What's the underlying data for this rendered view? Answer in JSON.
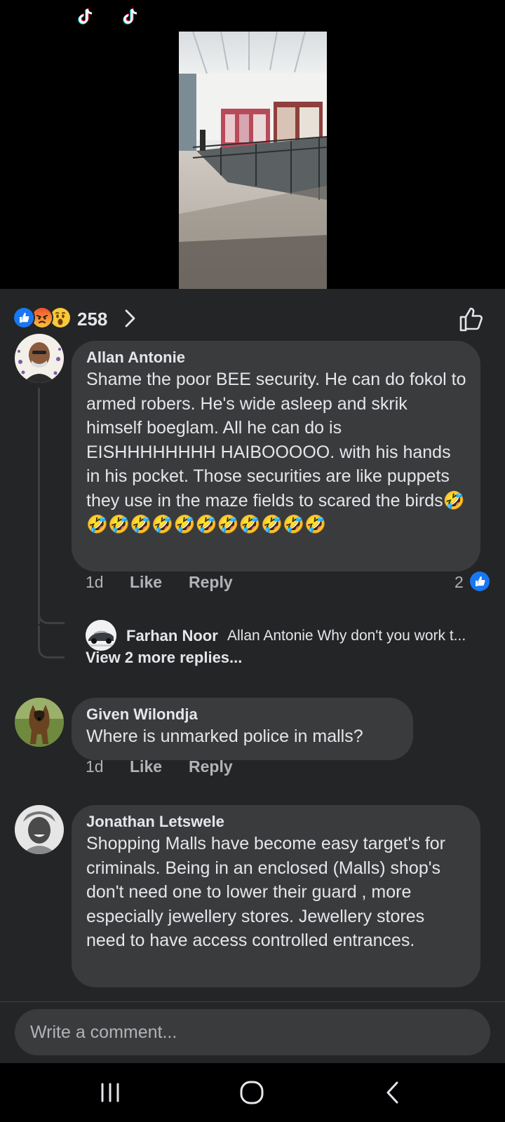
{
  "video": {
    "tiktok_icons": [
      "tiktok-icon",
      "tiktok-icon"
    ]
  },
  "reactions": {
    "icons": [
      "like-reaction",
      "angry-reaction",
      "wow-reaction"
    ],
    "count": "258"
  },
  "comments": [
    {
      "author": "Allan Antonie",
      "text": "Shame the poor BEE security. He can do fokol to armed robers. He's wide asleep and skrik himself boeglam. All he can do is EISHHHHHHHH HAIBOOOOO. with his hands in his pocket. Those securities are like puppets they use in the maze fields to scared the birds🤣🤣🤣🤣🤣🤣🤣🤣🤣🤣🤣🤣",
      "time": "1d",
      "like_label": "Like",
      "reply_label": "Reply",
      "like_count": "2",
      "reply_preview": {
        "author": "Farhan Noor",
        "text": "Allan Antonie Why don't you work t..."
      },
      "view_more": "View 2 more replies..."
    },
    {
      "author": "Given Wilondja",
      "text": "Where is unmarked police in malls?",
      "time": "1d",
      "like_label": "Like",
      "reply_label": "Reply"
    },
    {
      "author": "Jonathan Letswele",
      "text": "Shopping Malls have become easy target's for criminals. Being in an enclosed (Malls) shop's don't need one to lower their guard , more especially jewellery stores. Jewellery stores need to have access controlled entrances."
    }
  ],
  "composer": {
    "placeholder": "Write a comment..."
  },
  "colors": {
    "sheet_bg": "#242526",
    "bubble_bg": "#3a3b3c",
    "accent": "#1877f2"
  }
}
